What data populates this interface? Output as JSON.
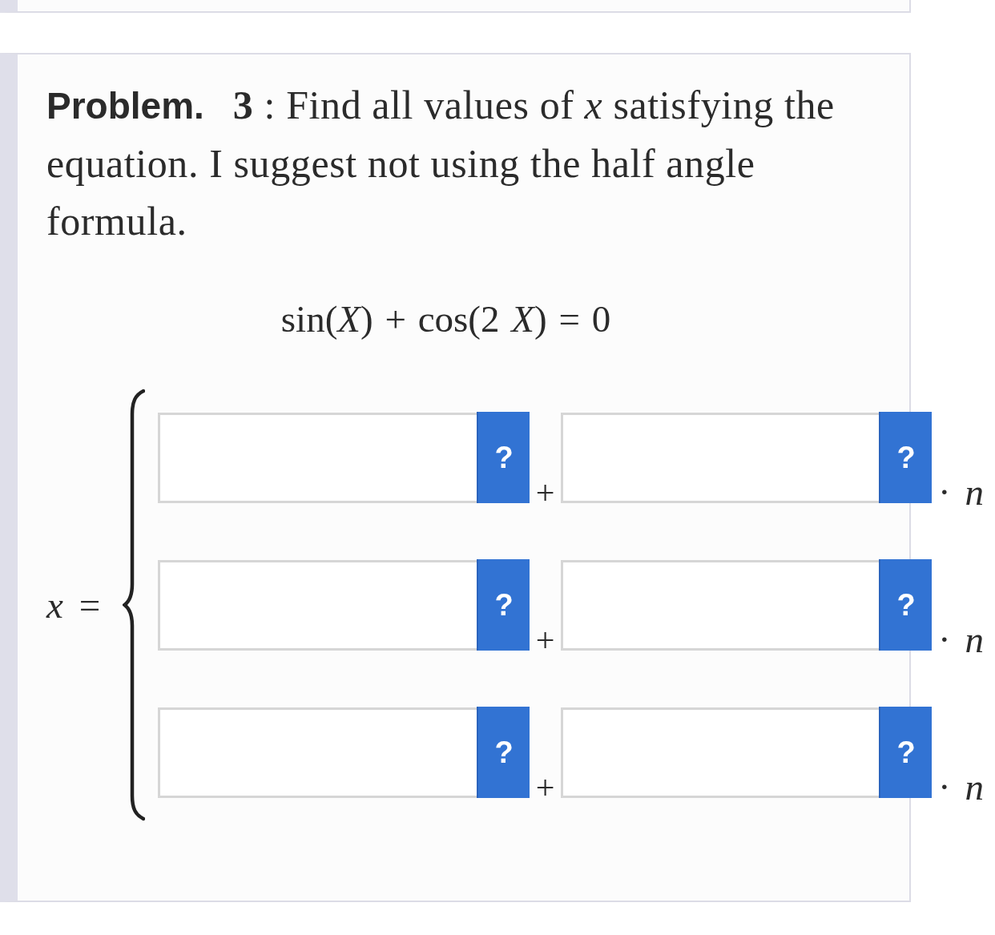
{
  "problem": {
    "label": "Problem.",
    "text": "**3** : Find all values of *x* satisfying the equation. I suggest not using the half angle formula."
  },
  "equation": "sin(*X*) + cos(2 *X*) = 0",
  "answer": {
    "lhs": "*x* =",
    "rows": [
      {
        "term_help": "?",
        "plus": "+",
        "coefficient_help": "?",
        "suffix": "· *n*"
      },
      {
        "term_help": "?",
        "plus": "+",
        "coefficient_help": "?",
        "suffix": "· *n*"
      },
      {
        "term_help": "?",
        "plus": "+",
        "coefficient_help": "?",
        "suffix": "· *n*"
      }
    ]
  }
}
